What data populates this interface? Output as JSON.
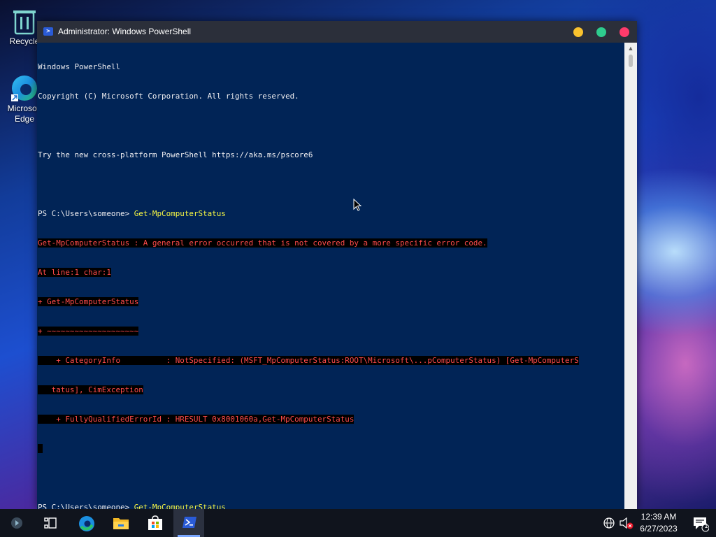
{
  "desktop": {
    "icons": [
      {
        "label": "Recycle",
        "icon": "recycle-bin-icon"
      },
      {
        "label": "Microsoft Edge",
        "icon": "edge-icon"
      }
    ]
  },
  "window": {
    "title": "Administrator: Windows PowerShell",
    "icon": "powershell-icon",
    "buttons": {
      "minimize": "minimize-button",
      "maximize": "maximize-button",
      "close": "close-button"
    }
  },
  "console": {
    "header1": "Windows PowerShell",
    "header2": "Copyright (C) Microsoft Corporation. All rights reserved.",
    "header3": "Try the new cross-platform PowerShell https://aka.ms/pscore6",
    "prompt1": "PS C:\\Users\\someone> ",
    "command1": "Get-MpComputerStatus",
    "error_lines": [
      "Get-MpComputerStatus : A general error occurred that is not covered by a more specific error code.",
      "At line:1 char:1",
      "+ Get-MpComputerStatus",
      "+ ~~~~~~~~~~~~~~~~~~~~",
      "    + CategoryInfo          : NotSpecified: (MSFT_MpComputerStatus:ROOT\\Microsoft\\...pComputerStatus) [Get-MpComputerS",
      "   tatus], CimException",
      "    + FullyQualifiedErrorId : HRESULT 0x8001060a,Get-MpComputerStatus",
      " "
    ],
    "prompt2": "PS C:\\Users\\someone> ",
    "command2": "Get-MpComputerStatus",
    "colors": {
      "background": "#012456",
      "text": "#eeedf0",
      "command": "#f5f543",
      "error": "#ff4b4b",
      "error_background": "#000000"
    }
  },
  "taskbar": {
    "items": [
      "start-button-icon",
      "task-view-icon",
      "edge-icon",
      "file-explorer-icon",
      "store-icon",
      "powershell-icon"
    ],
    "tray": {
      "time": "12:39 AM",
      "date": "6/27/2023",
      "notification_count": "1"
    }
  }
}
